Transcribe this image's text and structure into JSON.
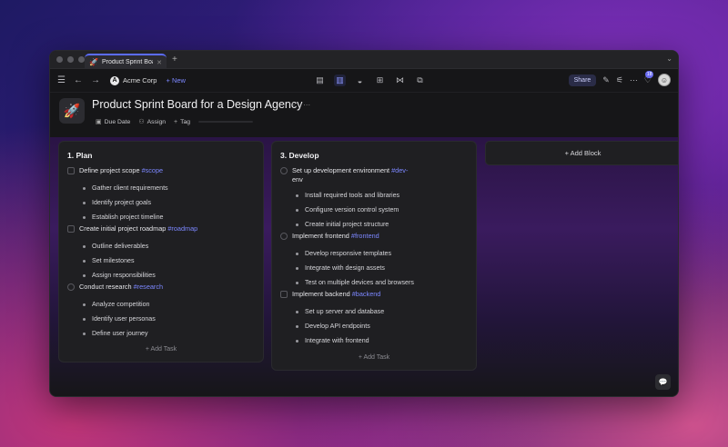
{
  "tab": {
    "title": "Product Sprint Board ...",
    "icon": "🚀"
  },
  "toolbar": {
    "org_name": "Acme Corp",
    "org_logo": "A",
    "new_label": "+ New",
    "share_label": "Share",
    "notif_count": "18"
  },
  "page": {
    "icon": "🚀",
    "title": "Product Sprint Board for a Design Agency",
    "meta": {
      "due_date": "Due Date",
      "assign": "Assign",
      "tag": "Tag"
    }
  },
  "columns": [
    {
      "title": "1. Plan",
      "add_task": "+ Add Task",
      "tasks": [
        {
          "text": "Define project scope ",
          "tag": "#scope",
          "subtasks": [
            "Gather client requirements",
            "Identify project goals",
            "Establish project timeline"
          ]
        },
        {
          "text": "Create initial project roadmap ",
          "tag": "#roadmap",
          "subtasks": [
            "Outline deliverables",
            "Set milestones",
            "Assign responsibilities"
          ]
        },
        {
          "text": "Conduct research ",
          "tag": "#research",
          "subtasks": [
            "Analyze competition",
            "Identify user personas",
            "Define user journey"
          ]
        }
      ]
    },
    {
      "title": "3. Develop",
      "add_task": "+ Add Task",
      "tasks": [
        {
          "text": "Set up development environment ",
          "tag": "#dev-",
          "tag2": "env",
          "subtasks": [
            "Install required tools and libraries",
            "Configure version control system",
            "Create initial project structure"
          ]
        },
        {
          "text": "Implement frontend ",
          "tag": "#frontend",
          "subtasks": [
            "Develop responsive templates",
            "Integrate with design assets",
            "Test on multiple devices and browsers"
          ]
        },
        {
          "text": "Implement backend ",
          "tag": "#backend",
          "subtasks": [
            "Set up server and database",
            "Develop API endpoints",
            "Integrate with frontend"
          ]
        }
      ]
    }
  ],
  "add_block_label": "+ Add Block",
  "colors": {
    "accent": "#7c87ff",
    "window_bg": "#161618",
    "card_bg": "#1f1f22"
  }
}
